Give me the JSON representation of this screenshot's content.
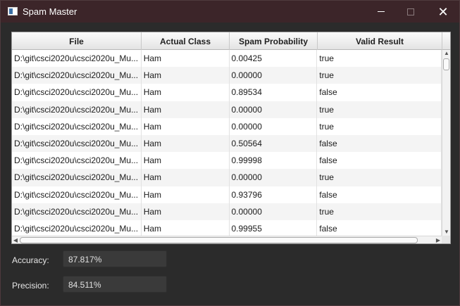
{
  "window": {
    "title": "Spam Master",
    "colors": {
      "titlebar": "#3c2529",
      "background": "#2b2b2b"
    }
  },
  "table": {
    "columns": [
      "File",
      "Actual Class",
      "Spam Probability",
      "Valid Result"
    ],
    "rows": [
      [
        "D:\\git\\csci2020u\\csci2020u_Mu...",
        "Ham",
        "0.00425",
        "true"
      ],
      [
        "D:\\git\\csci2020u\\csci2020u_Mu...",
        "Ham",
        "0.00000",
        "true"
      ],
      [
        "D:\\git\\csci2020u\\csci2020u_Mu...",
        "Ham",
        "0.89534",
        "false"
      ],
      [
        "D:\\git\\csci2020u\\csci2020u_Mu...",
        "Ham",
        "0.00000",
        "true"
      ],
      [
        "D:\\git\\csci2020u\\csci2020u_Mu...",
        "Ham",
        "0.00000",
        "true"
      ],
      [
        "D:\\git\\csci2020u\\csci2020u_Mu...",
        "Ham",
        "0.50564",
        "false"
      ],
      [
        "D:\\git\\csci2020u\\csci2020u_Mu...",
        "Ham",
        "0.99998",
        "false"
      ],
      [
        "D:\\git\\csci2020u\\csci2020u_Mu...",
        "Ham",
        "0.00000",
        "true"
      ],
      [
        "D:\\git\\csci2020u\\csci2020u_Mu...",
        "Ham",
        "0.93796",
        "false"
      ],
      [
        "D:\\git\\csci2020u\\csci2020u_Mu...",
        "Ham",
        "0.00000",
        "true"
      ],
      [
        "D:\\git\\csci2020u\\csci2020u_Mu...",
        "Ham",
        "0.99955",
        "false"
      ]
    ]
  },
  "stats": {
    "accuracy_label": "Accuracy:",
    "accuracy_value": "87.817%",
    "precision_label": "Precision:",
    "precision_value": "84.511%"
  }
}
